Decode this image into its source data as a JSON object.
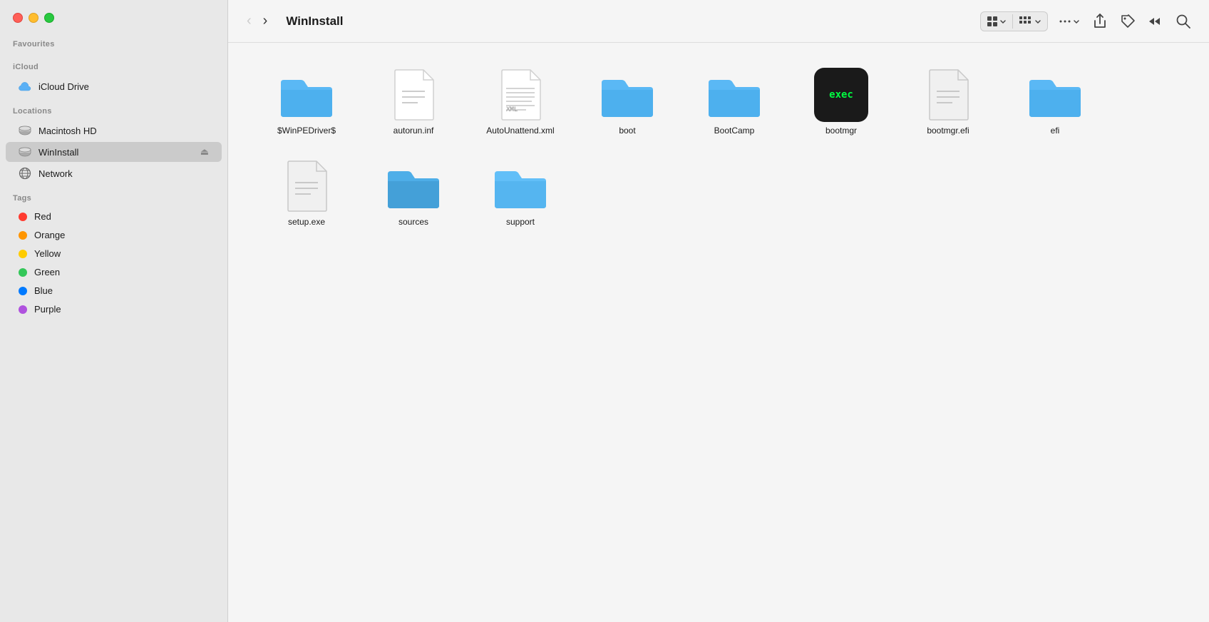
{
  "window": {
    "title": "WinInstall"
  },
  "trafficLights": {
    "close": "close",
    "minimize": "minimize",
    "maximize": "maximize"
  },
  "sidebar": {
    "favourites_label": "Favourites",
    "icloud_label": "iCloud",
    "icloud_drive_label": "iCloud Drive",
    "locations_label": "Locations",
    "macintosh_hd_label": "Macintosh HD",
    "wininstall_label": "WinInstall",
    "network_label": "Network",
    "tags_label": "Tags",
    "tags": [
      {
        "name": "Red",
        "color": "#ff3b30"
      },
      {
        "name": "Orange",
        "color": "#ff9500"
      },
      {
        "name": "Yellow",
        "color": "#ffcc00"
      },
      {
        "name": "Green",
        "color": "#34c759"
      },
      {
        "name": "Blue",
        "color": "#007aff"
      },
      {
        "name": "Purple",
        "color": "#af52de"
      }
    ]
  },
  "toolbar": {
    "back_label": "‹",
    "forward_label": "›",
    "title": "WinInstall",
    "view_grid_label": "⊞",
    "view_list_label": "≡",
    "more_label": "···",
    "share_label": "↑",
    "tag_label": "🏷",
    "more2_label": "»",
    "search_label": "⌕"
  },
  "files": [
    {
      "name": "$WinPEDriver$",
      "type": "folder"
    },
    {
      "name": "autorun.inf",
      "type": "document"
    },
    {
      "name": "AutoUnattend.xml",
      "type": "xml"
    },
    {
      "name": "boot",
      "type": "folder"
    },
    {
      "name": "BootCamp",
      "type": "folder"
    },
    {
      "name": "bootmgr",
      "type": "exec"
    },
    {
      "name": "bootmgr.efi",
      "type": "document_gray"
    },
    {
      "name": "efi",
      "type": "folder"
    },
    {
      "name": "setup.exe",
      "type": "document_gray"
    },
    {
      "name": "sources",
      "type": "folder_dark"
    },
    {
      "name": "support",
      "type": "folder_light"
    }
  ]
}
